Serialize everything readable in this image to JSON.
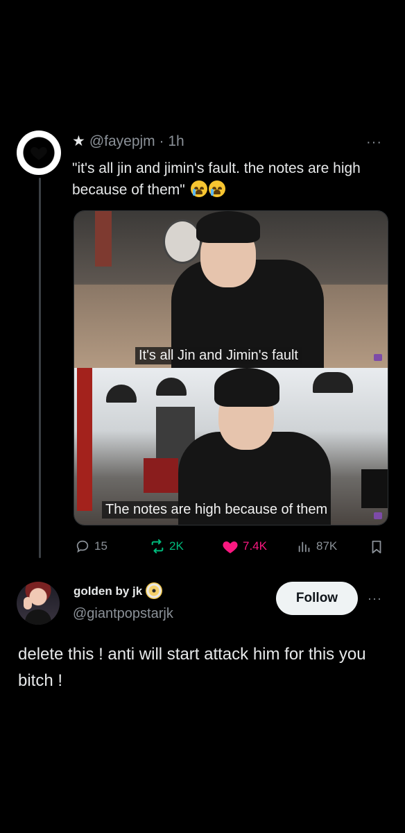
{
  "quoted_post": {
    "star": "★",
    "handle": "@fayepjm",
    "separator": "·",
    "time": "1h",
    "more": "···",
    "text": "\"it's all jin and jimin's fault. the notes are high because of them\"",
    "emoji": "loudly-crying-face",
    "media": {
      "caption_top": "It's all Jin and Jimin's fault",
      "caption_bottom": "The notes are high because of them"
    },
    "stats": {
      "replies": "15",
      "reposts": "2K",
      "likes": "7.4K",
      "views": "87K"
    },
    "colors": {
      "repost": "#00ba7c",
      "like": "#f91880",
      "muted": "#8b9198"
    }
  },
  "reply": {
    "display_name": "golden by jk",
    "handle": "@giantpopstarjk",
    "follow_label": "Follow",
    "more": "···",
    "text": "delete this ! anti will start attack him for this you bitch !"
  }
}
